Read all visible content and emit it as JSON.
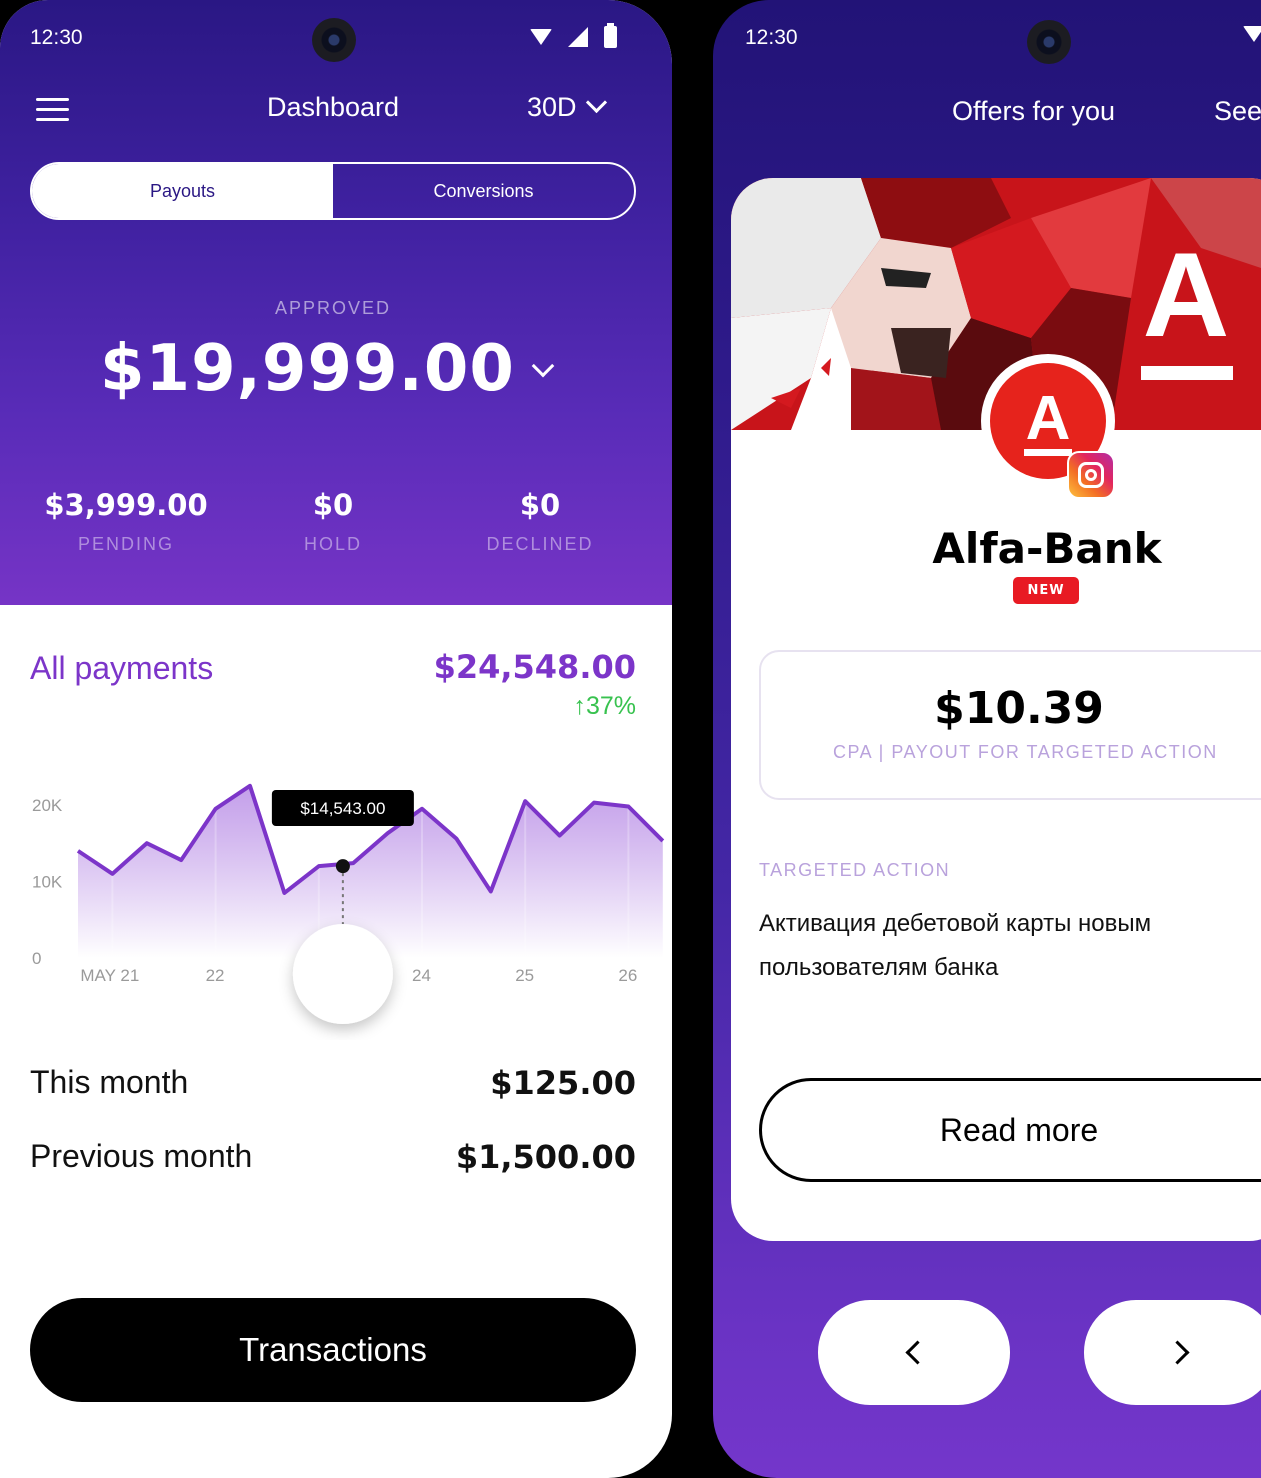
{
  "status": {
    "time": "12:30"
  },
  "dashboard": {
    "title": "Dashboard",
    "period": "30D",
    "tabs": [
      {
        "label": "Payouts",
        "active": true
      },
      {
        "label": "Conversions",
        "active": false
      }
    ],
    "approved": {
      "label": "APPROVED",
      "value": "$19,999.00"
    },
    "stats": [
      {
        "value": "$3,999.00",
        "label": "PENDING"
      },
      {
        "value": "$0",
        "label": "HOLD"
      },
      {
        "value": "$0",
        "label": "DECLINED"
      }
    ],
    "all_payments": {
      "label": "All payments",
      "value": "$24,548.00",
      "change": "↑37%"
    },
    "rows": [
      {
        "label": "This month",
        "value": "$125.00"
      },
      {
        "label": "Previous month",
        "value": "$1,500.00"
      }
    ],
    "transactions_button": "Transactions"
  },
  "chart_data": {
    "type": "area",
    "y_ticks": [
      "20K",
      "10K",
      "0"
    ],
    "ylim": [
      0,
      23000
    ],
    "x_tick_labels": [
      "MAY 21",
      "22",
      "23",
      "24",
      "25",
      "26"
    ],
    "x_tick_positions": [
      1,
      4,
      7,
      10,
      13,
      16
    ],
    "x": [
      0,
      1,
      2,
      3,
      4,
      5,
      6,
      7,
      8,
      9,
      10,
      11,
      12,
      13,
      14,
      15,
      16,
      17
    ],
    "values": [
      14000,
      11000,
      15000,
      12800,
      19500,
      22500,
      8500,
      12000,
      12400,
      16300,
      19500,
      15600,
      8700,
      20500,
      16000,
      20300,
      19800,
      15300
    ],
    "tooltip": {
      "x": 7.7,
      "value": 12000,
      "label": "$14,543.00"
    },
    "color": "#7c35c9"
  },
  "offers": {
    "title": "Offers for you",
    "see_label": "See all",
    "brand_name": "Alfa-Bank",
    "logo_letter": "A",
    "badge": "NEW",
    "payout_value": "$10.39",
    "payout_desc": "CPA | PAYOUT FOR TARGETED ACTION",
    "targeted_action_label": "TARGETED ACTION",
    "targeted_action_text": "Активация дебетовой карты новым пользователям банка",
    "read_more": "Read more",
    "accent": "#e6231c"
  }
}
